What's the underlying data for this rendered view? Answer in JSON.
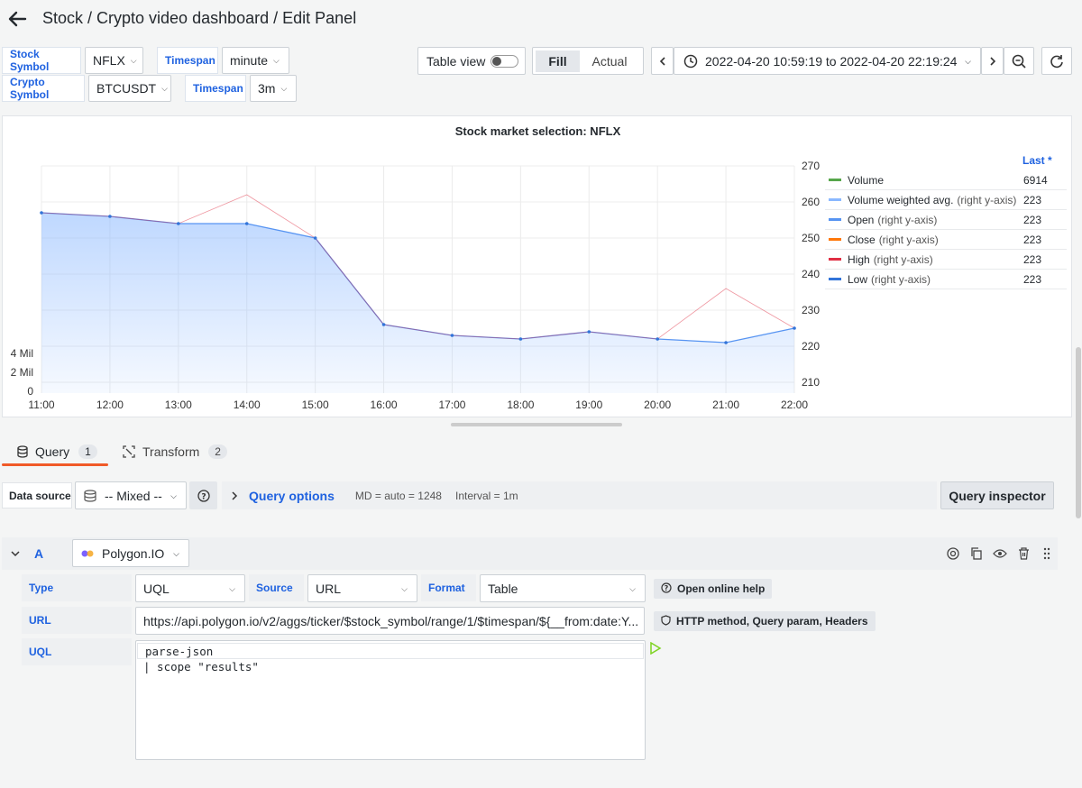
{
  "header": {
    "title": "Stock / Crypto video dashboard / Edit Panel",
    "back_icon": "arrow-left-icon"
  },
  "variables": [
    {
      "label": "Stock Symbol",
      "value": "NFLX"
    },
    {
      "label": "Timespan",
      "value": "minute"
    },
    {
      "label": "Crypto Symbol",
      "value": "BTCUSDT"
    },
    {
      "label": "Timespan",
      "value": "3m"
    }
  ],
  "toolbar": {
    "table_view_label": "Table view",
    "table_view_on": false,
    "fill_label": "Fill",
    "actual_label": "Actual",
    "time_range": "2022-04-20 10:59:19 to 2022-04-20 22:19:24"
  },
  "panel": {
    "title": "Stock market selection: NFLX",
    "legend_header": "Last *",
    "legend": [
      {
        "name": "Volume",
        "axis": "",
        "value": "6914",
        "color": "#56a64b"
      },
      {
        "name": "Volume weighted avg.",
        "axis": "(right y-axis)",
        "value": "223",
        "color": "#8ab8ff"
      },
      {
        "name": "Open",
        "axis": "(right y-axis)",
        "value": "223",
        "color": "#5794f2"
      },
      {
        "name": "Close",
        "axis": "(right y-axis)",
        "value": "223",
        "color": "#ff780a"
      },
      {
        "name": "High",
        "axis": "(right y-axis)",
        "value": "223",
        "color": "#e02f44"
      },
      {
        "name": "Low",
        "axis": "(right y-axis)",
        "value": "223",
        "color": "#3274d9"
      }
    ]
  },
  "chart_data": {
    "type": "line",
    "x": [
      "11:00",
      "12:00",
      "13:00",
      "14:00",
      "15:00",
      "16:00",
      "17:00",
      "18:00",
      "19:00",
      "20:00",
      "21:00",
      "22:00"
    ],
    "left_ticks": [
      "0",
      "2 Mil",
      "4 Mil"
    ],
    "right_ticks": [
      "210",
      "220",
      "230",
      "240",
      "250",
      "260",
      "270"
    ],
    "right_ylim": [
      207,
      270
    ],
    "series": [
      {
        "name": "Volume weighted avg.",
        "values": [
          257,
          256,
          254,
          254,
          250,
          226,
          223,
          222,
          224,
          222,
          221,
          225
        ]
      },
      {
        "name": "High",
        "values": [
          257,
          256,
          254,
          262,
          250,
          226,
          223,
          222,
          224,
          222,
          236,
          225
        ]
      }
    ]
  },
  "tabs": [
    {
      "label": "Query",
      "count": "1"
    },
    {
      "label": "Transform",
      "count": "2"
    }
  ],
  "query_row": {
    "datasource_label": "Data source",
    "datasource_value": "-- Mixed --",
    "query_options_label": "Query options",
    "md": "MD = auto = 1248",
    "interval": "Interval = 1m",
    "inspector_label": "Query inspector"
  },
  "query_a": {
    "letter": "A",
    "datasource": "Polygon.IO",
    "type_label": "Type",
    "type_value": "UQL",
    "source_label": "Source",
    "source_value": "URL",
    "format_label": "Format",
    "format_value": "Table",
    "help_label": "Open online help",
    "url_label": "URL",
    "url_value": "https://api.polygon.io/v2/aggs/ticker/$stock_symbol/range/1/$timespan/${__from:date:Y...",
    "http_label": "HTTP method, Query param, Headers",
    "uql_label": "UQL",
    "uql_lines": [
      "parse-json",
      "| scope \"results\""
    ]
  }
}
